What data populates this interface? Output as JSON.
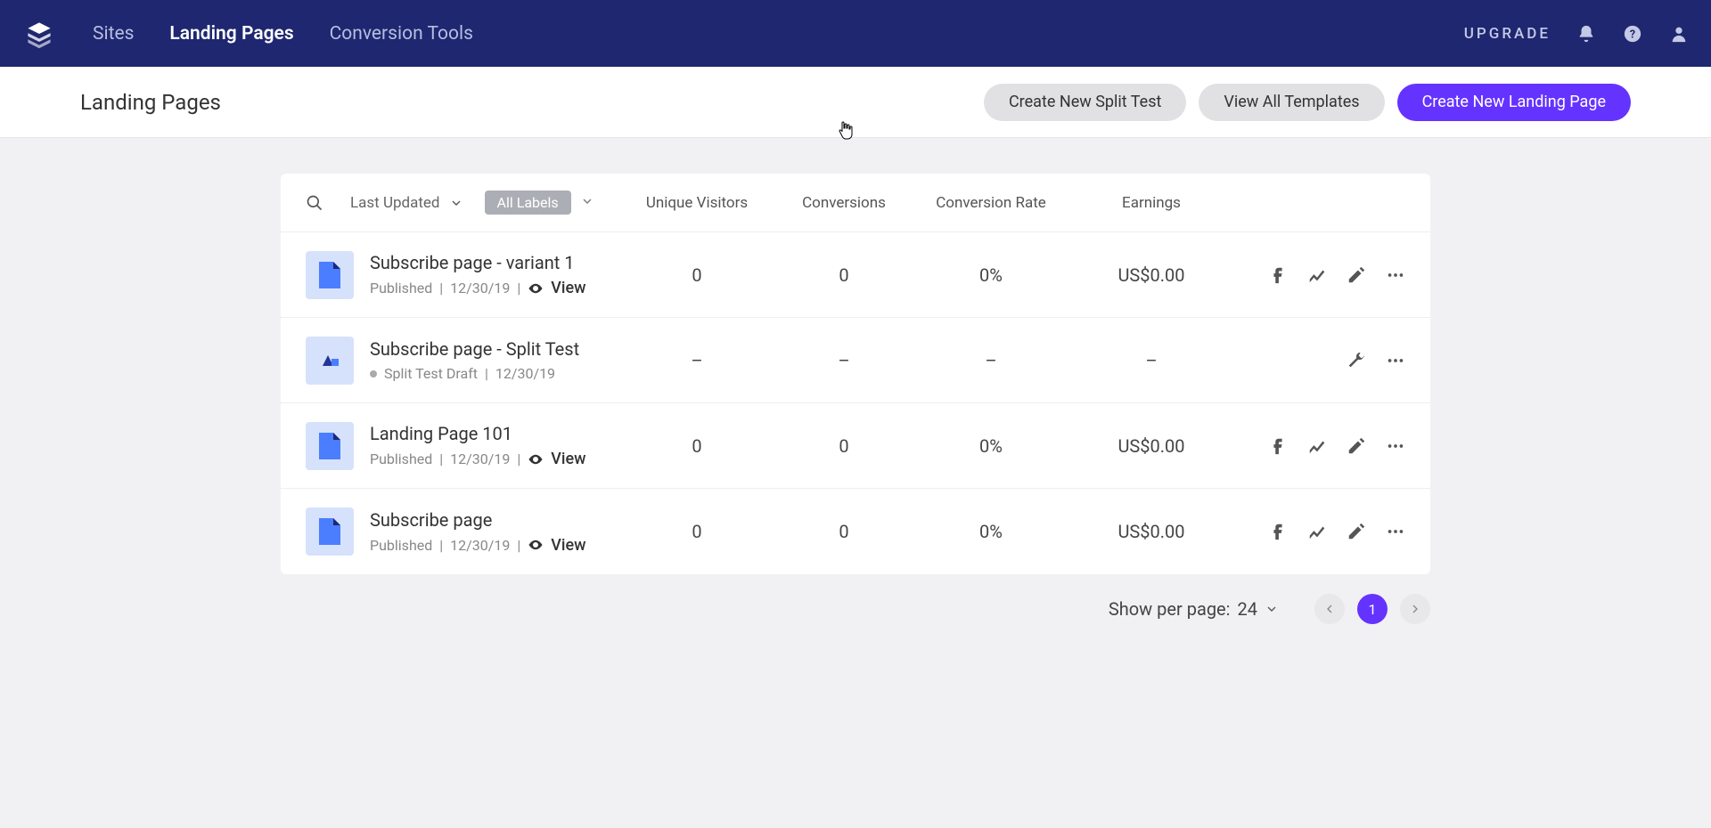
{
  "nav": {
    "sites": "Sites",
    "landing": "Landing Pages",
    "conversion": "Conversion Tools",
    "upgrade": "UPGRADE"
  },
  "header": {
    "title": "Landing Pages",
    "btn_split": "Create New Split Test",
    "btn_templates": "View All Templates",
    "btn_new": "Create New Landing Page"
  },
  "table": {
    "sort": "Last Updated",
    "label_chip": "All Labels",
    "cols": {
      "uv": "Unique Visitors",
      "cv": "Conversions",
      "cr": "Conversion Rate",
      "er": "Earnings"
    }
  },
  "rows": [
    {
      "title": "Subscribe page - variant 1",
      "status": "Published",
      "date": "12/30/19",
      "view": "View",
      "uv": "0",
      "cv": "0",
      "cr": "0%",
      "er": "US$0.00",
      "type": "page"
    },
    {
      "title": "Subscribe page - Split Test",
      "status": "Split Test Draft",
      "date": "12/30/19",
      "uv": "–",
      "cv": "–",
      "cr": "–",
      "er": "–",
      "type": "split"
    },
    {
      "title": "Landing Page 101",
      "status": "Published",
      "date": "12/30/19",
      "view": "View",
      "uv": "0",
      "cv": "0",
      "cr": "0%",
      "er": "US$0.00",
      "type": "page"
    },
    {
      "title": "Subscribe page",
      "status": "Published",
      "date": "12/30/19",
      "view": "View",
      "uv": "0",
      "cv": "0",
      "cr": "0%",
      "er": "US$0.00",
      "type": "page"
    }
  ],
  "pagination": {
    "label": "Show per page:",
    "per": "24",
    "current": "1"
  }
}
